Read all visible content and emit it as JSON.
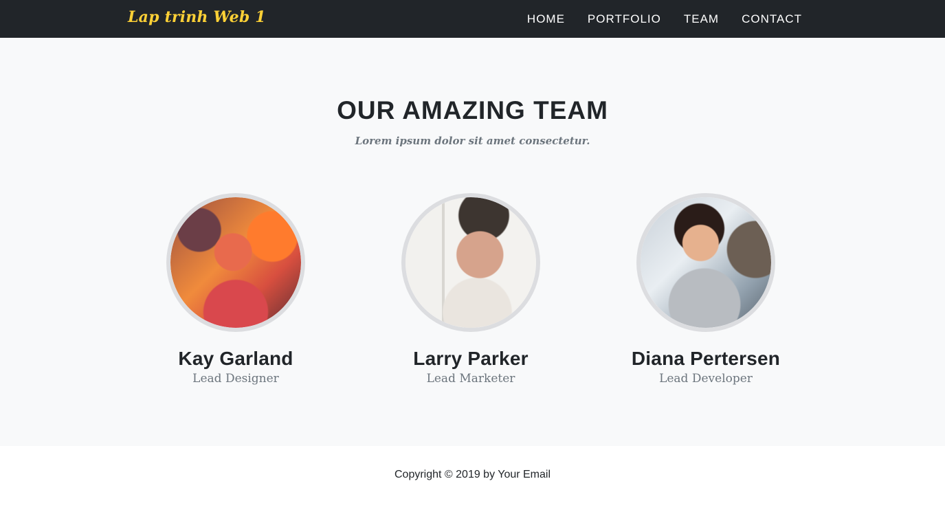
{
  "header": {
    "brand": "Lap trinh Web 1",
    "nav": {
      "home": "HOME",
      "portfolio": "PORTFOLIO",
      "team": "TEAM",
      "contact": "CONTACT"
    }
  },
  "team_section": {
    "heading": "OUR AMAZING TEAM",
    "subheading": "Lorem ipsum dolor sit amet consectetur.",
    "members": [
      {
        "name": "Kay Garland",
        "role": "Lead Designer"
      },
      {
        "name": "Larry Parker",
        "role": "Lead Marketer"
      },
      {
        "name": "Diana Pertersen",
        "role": "Lead Developer"
      }
    ]
  },
  "footer": {
    "copyright": "Copyright © 2019 by Your Email"
  },
  "colors": {
    "navbar_bg": "#212529",
    "brand": "#fed136",
    "page_bg": "#f8f9fa",
    "text_dark": "#212529",
    "text_muted": "#6c757d"
  }
}
